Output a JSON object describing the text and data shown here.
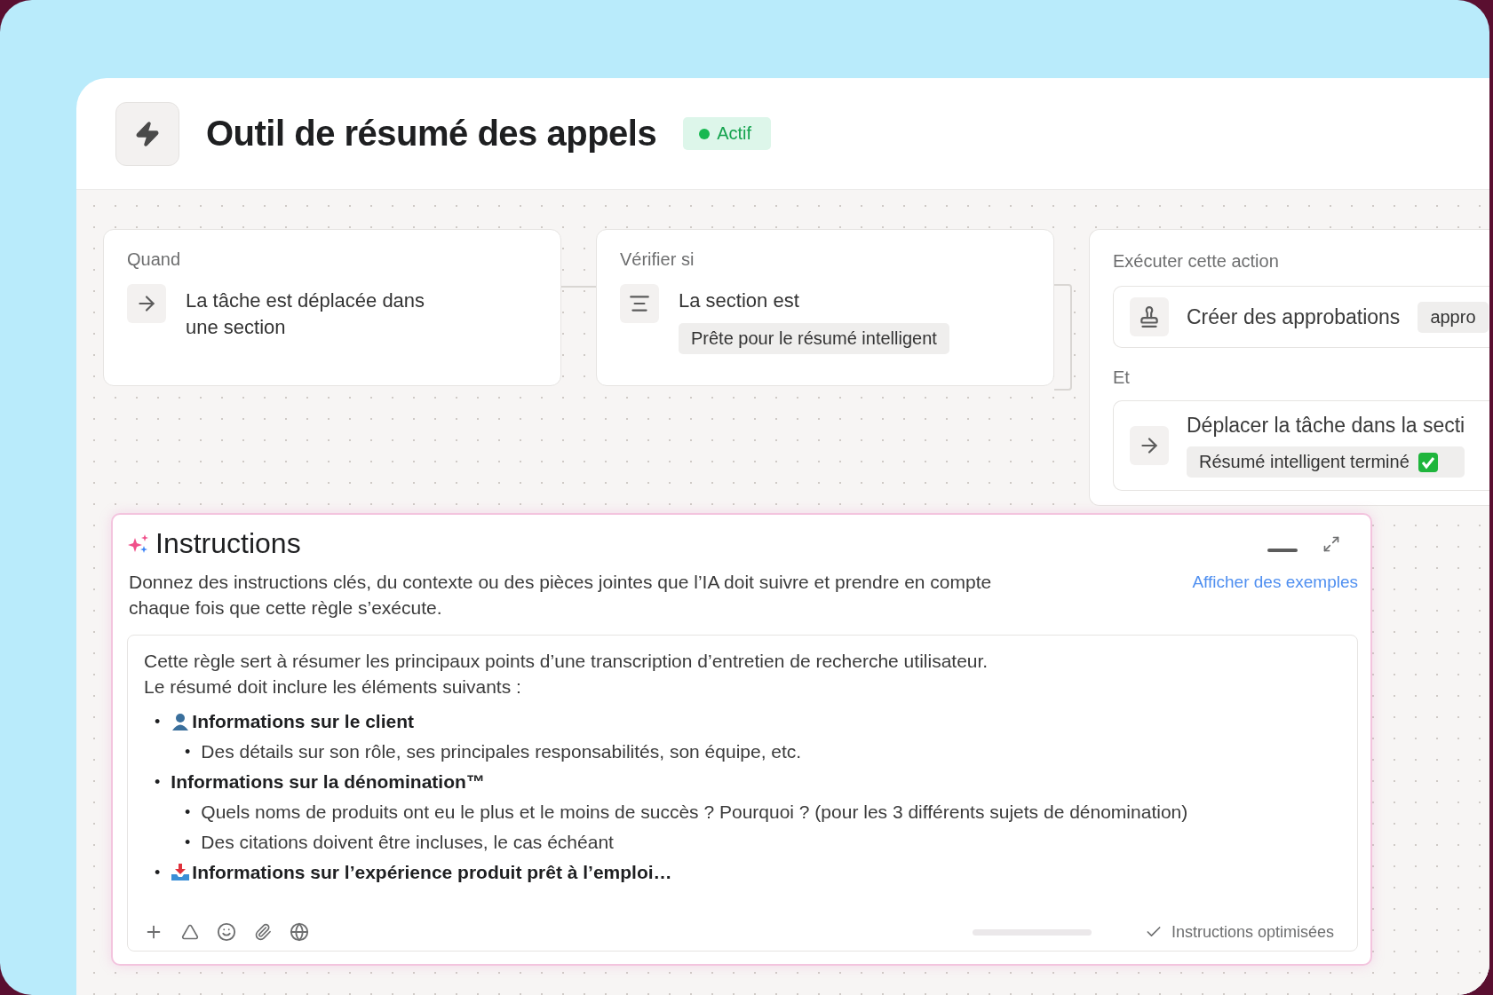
{
  "header": {
    "title": "Outil de résumé des appels",
    "status": "Actif"
  },
  "steps": [
    {
      "kind": "trigger",
      "label": "Quand",
      "text": "La tâche est déplacée dans une section"
    },
    {
      "kind": "condition",
      "label": "Vérifier si",
      "text": "La section est",
      "tag": "Prête pour le résumé intelligent"
    },
    {
      "kind": "actions",
      "label": "Exécuter cette action",
      "joiner": "Et",
      "actions": [
        {
          "kind": "approval",
          "text": "Créer des approbations",
          "tag": "appro",
          "tag_check": false
        },
        {
          "kind": "move",
          "text": "Déplacer la tâche dans la secti",
          "tag": "Résumé intelligent terminé",
          "tag_check": true
        }
      ]
    }
  ],
  "instructions": {
    "title": "Instructions",
    "description": "Donnez des instructions clés, du contexte ou des pièces jointes que l’IA doit suivre et prendre en compte chaque fois que cette règle s’exécute.",
    "examples_link": "Afficher des exemples",
    "intro": [
      "Cette règle sert à résumer les principaux points d’une transcription d’entretien de recherche utilisateur.",
      "Le résumé doit inclure les éléments suivants :"
    ],
    "bullets": [
      {
        "kind": "person",
        "marker": "•",
        "text": "Informations sur le client",
        "children": [
          {
            "marker": "•",
            "text": "Des détails sur son rôle, ses principales responsabilités, son équipe, etc."
          }
        ]
      },
      {
        "kind": "plain",
        "marker": "•",
        "text": "Informations sur la dénomination™",
        "children": [
          {
            "marker": "•",
            "text": "Quels noms de produits ont eu le plus et le moins de succès ? Pourquoi ? (pour les 3 différents sujets de dénomination)"
          },
          {
            "marker": "•",
            "text": "Des citations doivent être incluses, le cas échéant"
          }
        ]
      },
      {
        "kind": "tray",
        "marker": "•",
        "text": "Informations sur l’expérience produit prêt à l’emploi…"
      }
    ],
    "status": "Instructions optimisées"
  }
}
